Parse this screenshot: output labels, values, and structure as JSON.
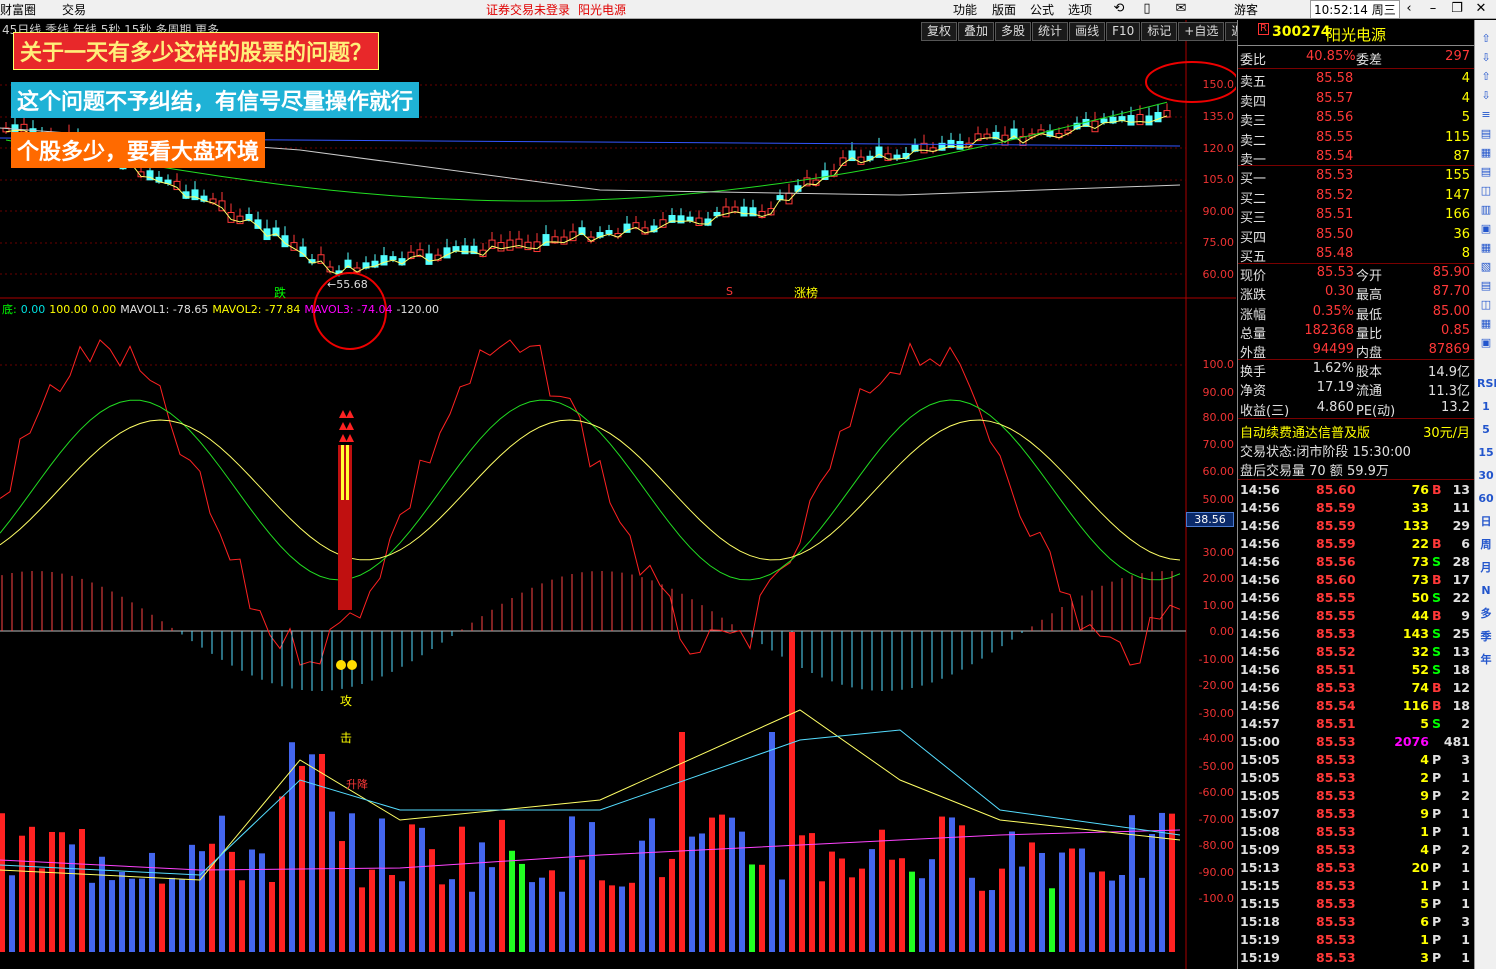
{
  "topbar": {
    "app_title": "财富圈",
    "trade": "交易",
    "warning": "证券交易未登录",
    "stock_title": "阳光电源",
    "menu": [
      "功能",
      "版面",
      "公式",
      "选项"
    ],
    "user": "游客",
    "clock": "10:52:14 周三"
  },
  "chart_header": {
    "period_tabs": "45日线  季线  年线  5秒  15秒  多周期  更多"
  },
  "toolbar": [
    "复权",
    "叠加",
    "多股",
    "统计",
    "画线",
    "F10",
    "标记",
    "+自选",
    "返回"
  ],
  "banners": {
    "b1": "关于一天有多少这样的股票的问题？",
    "b2": "这个问题不予纠结，有信号尽量操作就行",
    "b3": "个股多少，要看大盘环境"
  },
  "price_axis": [
    "150.0",
    "135.0",
    "120.0",
    "105.0",
    "90.00",
    "75.00",
    "60.00"
  ],
  "indicator_axis": [
    "100.0",
    "90.00",
    "80.00",
    "70.00",
    "60.00",
    "50.00",
    "30.00",
    "20.00",
    "10.00",
    "0.00",
    "-10.00",
    "-20.00",
    "-30.00",
    "-40.00",
    "-50.00",
    "-60.00",
    "-70.00",
    "-80.00",
    "-90.00",
    "-100.0"
  ],
  "current_value_tag": "38.56",
  "chart_labels": {
    "low_price": "55.68",
    "die": "跌",
    "zhangting": "涨榜",
    "s_mark": "S",
    "gong": "攻",
    "ji": "击",
    "shenglong": "升降"
  },
  "kdj_info": {
    "prefix": "底:",
    "v1": "0.00",
    "v2": "100.00",
    "v3": "0.00",
    "mavol1": "MAVOL1: -78.65",
    "mavol2": "MAVOL2: -77.84",
    "mavol3": "MAVOL3: -74.04",
    "v4": "-120.00"
  },
  "stock": {
    "r_badge": "R",
    "code": "300274",
    "name": "阳光电源",
    "weibi_label": "委比",
    "weibi_value": "40.85%",
    "weicha_label": "委差",
    "weicha_value": "297"
  },
  "asks": [
    {
      "label": "卖五",
      "price": "85.58",
      "vol": "4"
    },
    {
      "label": "卖四",
      "price": "85.57",
      "vol": "4"
    },
    {
      "label": "卖三",
      "price": "85.56",
      "vol": "5"
    },
    {
      "label": "卖二",
      "price": "85.55",
      "vol": "115"
    },
    {
      "label": "卖一",
      "price": "85.54",
      "vol": "87"
    }
  ],
  "bids": [
    {
      "label": "买一",
      "price": "85.53",
      "vol": "155"
    },
    {
      "label": "买二",
      "price": "85.52",
      "vol": "147"
    },
    {
      "label": "买三",
      "price": "85.51",
      "vol": "166"
    },
    {
      "label": "买四",
      "price": "85.50",
      "vol": "36"
    },
    {
      "label": "买五",
      "price": "85.48",
      "vol": "8"
    }
  ],
  "quote": [
    {
      "l1": "现价",
      "v1": "85.53",
      "l2": "今开",
      "v2": "85.90"
    },
    {
      "l1": "涨跌",
      "v1": "0.30",
      "l2": "最高",
      "v2": "87.70"
    },
    {
      "l1": "涨幅",
      "v1": "0.35%",
      "l2": "最低",
      "v2": "85.00"
    },
    {
      "l1": "总量",
      "v1": "182368",
      "l2": "量比",
      "v2": "0.85"
    },
    {
      "l1": "外盘",
      "v1": "94499",
      "l2": "内盘",
      "v2": "87869"
    }
  ],
  "fundamentals": [
    {
      "l1": "换手",
      "v1": "1.62%",
      "l2": "股本",
      "v2": "14.9亿"
    },
    {
      "l1": "净资",
      "v1": "17.19",
      "l2": "流通",
      "v2": "11.3亿"
    },
    {
      "l1": "收益(三)",
      "v1": "4.860",
      "l2": "PE(动)",
      "v2": "13.2"
    }
  ],
  "promo": {
    "text": "自动续费通达信普及版",
    "price": "30元/月"
  },
  "trade_status": "交易状态:闭市阶段 15:30:00",
  "after_hours": "盘后交易量 70 额 59.9万",
  "ticks": [
    {
      "t": "14:56",
      "p": "85.60",
      "v": "76",
      "d": "B",
      "n": "13"
    },
    {
      "t": "14:56",
      "p": "85.59",
      "v": "33",
      "d": "",
      "n": "11"
    },
    {
      "t": "14:56",
      "p": "85.59",
      "v": "133",
      "d": "",
      "n": "29"
    },
    {
      "t": "14:56",
      "p": "85.59",
      "v": "22",
      "d": "B",
      "n": "6"
    },
    {
      "t": "14:56",
      "p": "85.56",
      "v": "73",
      "d": "S",
      "n": "28"
    },
    {
      "t": "14:56",
      "p": "85.60",
      "v": "73",
      "d": "B",
      "n": "17"
    },
    {
      "t": "14:56",
      "p": "85.55",
      "v": "50",
      "d": "S",
      "n": "22"
    },
    {
      "t": "14:56",
      "p": "85.55",
      "v": "44",
      "d": "B",
      "n": "9"
    },
    {
      "t": "14:56",
      "p": "85.53",
      "v": "143",
      "d": "S",
      "n": "25"
    },
    {
      "t": "14:56",
      "p": "85.52",
      "v": "32",
      "d": "S",
      "n": "13"
    },
    {
      "t": "14:56",
      "p": "85.51",
      "v": "52",
      "d": "S",
      "n": "18"
    },
    {
      "t": "14:56",
      "p": "85.53",
      "v": "74",
      "d": "B",
      "n": "12"
    },
    {
      "t": "14:56",
      "p": "85.54",
      "v": "116",
      "d": "B",
      "n": "18"
    },
    {
      "t": "14:57",
      "p": "85.51",
      "v": "5",
      "d": "S",
      "n": "2"
    },
    {
      "t": "15:00",
      "p": "85.53",
      "v": "2076",
      "d": "",
      "n": "481"
    },
    {
      "t": "15:05",
      "p": "85.53",
      "v": "4",
      "d": "P",
      "n": "3"
    },
    {
      "t": "15:05",
      "p": "85.53",
      "v": "2",
      "d": "P",
      "n": "1"
    },
    {
      "t": "15:05",
      "p": "85.53",
      "v": "9",
      "d": "P",
      "n": "2"
    },
    {
      "t": "15:07",
      "p": "85.53",
      "v": "9",
      "d": "P",
      "n": "1"
    },
    {
      "t": "15:08",
      "p": "85.53",
      "v": "1",
      "d": "P",
      "n": "1"
    },
    {
      "t": "15:09",
      "p": "85.53",
      "v": "4",
      "d": "P",
      "n": "2"
    },
    {
      "t": "15:13",
      "p": "85.53",
      "v": "20",
      "d": "P",
      "n": "1"
    },
    {
      "t": "15:15",
      "p": "85.53",
      "v": "1",
      "d": "P",
      "n": "1"
    },
    {
      "t": "15:15",
      "p": "85.53",
      "v": "5",
      "d": "P",
      "n": "1"
    },
    {
      "t": "15:18",
      "p": "85.53",
      "v": "6",
      "d": "P",
      "n": "3"
    },
    {
      "t": "15:19",
      "p": "85.53",
      "v": "1",
      "d": "P",
      "n": "1"
    },
    {
      "t": "15:19",
      "p": "85.53",
      "v": "3",
      "d": "P",
      "n": "1"
    }
  ],
  "icon_strip": [
    "RSI",
    "1",
    "5",
    "15",
    "30",
    "60",
    "日",
    "周",
    "月",
    "N",
    "多",
    "季",
    "年"
  ],
  "colors": {
    "up": "#ff3838",
    "down": "#00e0e0",
    "bg": "#000000",
    "price_text": "#ff3838",
    "volume_text": "#ffff00"
  }
}
